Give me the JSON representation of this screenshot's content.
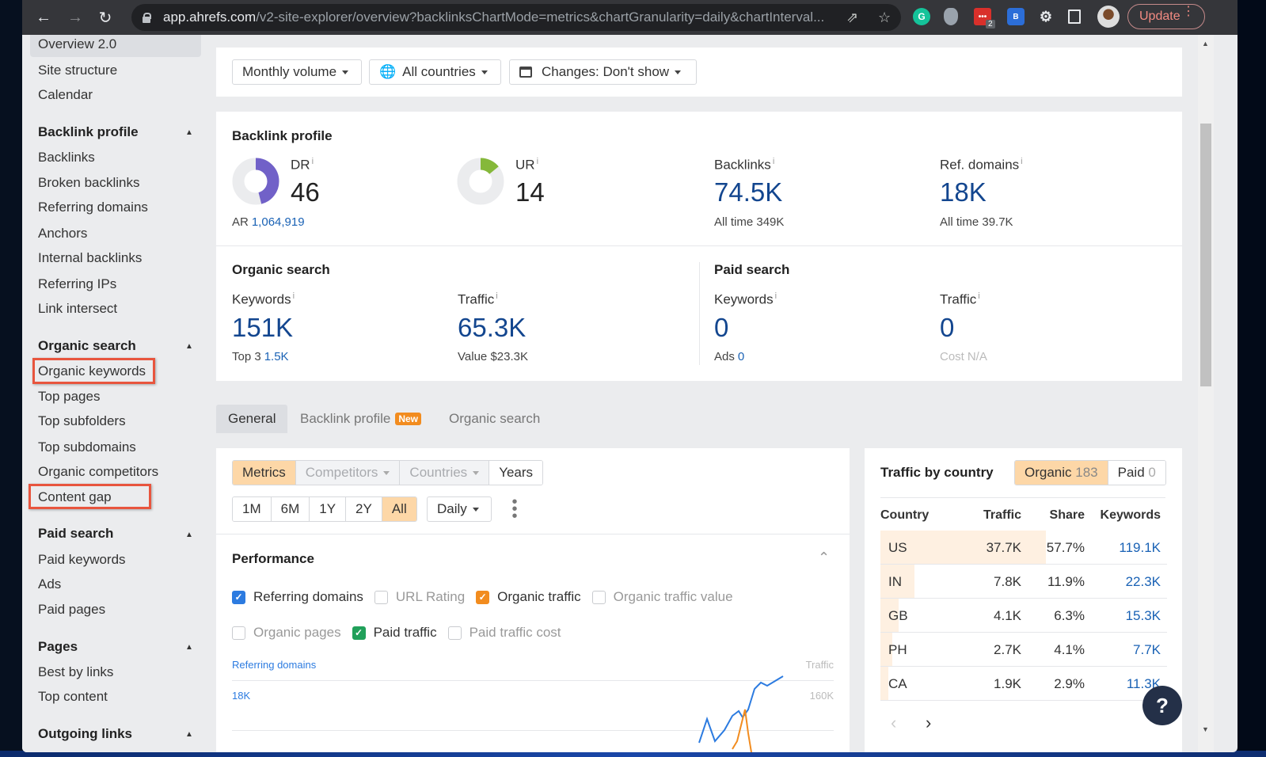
{
  "browser": {
    "url_host": "app.ahrefs.com",
    "url_path": "/v2-site-explorer/overview?backlinksChartMode=metrics&chartGranularity=daily&chartInterval...",
    "extension_badge": "2",
    "update_label": "Update"
  },
  "sidebar": {
    "top_items": [
      "Overview 2.0",
      "Site structure",
      "Calendar"
    ],
    "sections": [
      {
        "title": "Backlink profile",
        "items": [
          "Backlinks",
          "Broken backlinks",
          "Referring domains",
          "Anchors",
          "Internal backlinks",
          "Referring IPs",
          "Link intersect"
        ]
      },
      {
        "title": "Organic search",
        "items": [
          "Organic keywords",
          "Top pages",
          "Top subfolders",
          "Top subdomains",
          "Organic competitors",
          "Content gap"
        ]
      },
      {
        "title": "Paid search",
        "items": [
          "Paid keywords",
          "Ads",
          "Paid pages"
        ]
      },
      {
        "title": "Pages",
        "items": [
          "Best by links",
          "Top content"
        ]
      },
      {
        "title": "Outgoing links",
        "items": []
      }
    ]
  },
  "filters": {
    "volume": "Monthly volume",
    "countries": "All countries",
    "changes": "Changes: Don't show"
  },
  "backlink_profile": {
    "title": "Backlink profile",
    "dr_label": "DR",
    "dr_value": "46",
    "dr_percent": 46,
    "ar_label": "AR",
    "ar_value": "1,064,919",
    "ur_label": "UR",
    "ur_value": "14",
    "ur_percent": 14,
    "backlinks_label": "Backlinks",
    "backlinks_value": "74.5K",
    "backlinks_alltime_label": "All time",
    "backlinks_alltime_value": "349K",
    "refdomains_label": "Ref. domains",
    "refdomains_value": "18K",
    "refdomains_alltime_label": "All time",
    "refdomains_alltime_value": "39.7K",
    "info": "i"
  },
  "organic_search": {
    "title": "Organic search",
    "keywords_label": "Keywords",
    "keywords_value": "151K",
    "top3_label": "Top 3",
    "top3_value": "1.5K",
    "traffic_label": "Traffic",
    "traffic_value": "65.3K",
    "value_label": "Value",
    "value_value": "$23.3K"
  },
  "paid_search": {
    "title": "Paid search",
    "keywords_label": "Keywords",
    "keywords_value": "0",
    "ads_label": "Ads",
    "ads_value": "0",
    "traffic_label": "Traffic",
    "traffic_value": "0",
    "cost_label": "Cost",
    "cost_value": "N/A"
  },
  "tabs": [
    {
      "label": "General",
      "active": true
    },
    {
      "label": "Backlink profile",
      "badge": "New"
    },
    {
      "label": "Organic search"
    }
  ],
  "chart_controls": {
    "modes": [
      "Metrics",
      "Competitors",
      "Countries",
      "Years"
    ],
    "ranges": [
      "1M",
      "6M",
      "1Y",
      "2Y",
      "All"
    ],
    "active_range": "All",
    "granularity": "Daily"
  },
  "performance": {
    "title": "Performance",
    "checkboxes": [
      {
        "label": "Referring domains",
        "checked": true,
        "color": "#2c7be0"
      },
      {
        "label": "URL Rating",
        "checked": false
      },
      {
        "label": "Organic traffic",
        "checked": true,
        "color": "#f28c1f"
      },
      {
        "label": "Organic traffic value",
        "checked": false
      },
      {
        "label": "Organic pages",
        "checked": false
      },
      {
        "label": "Paid traffic",
        "checked": true,
        "color": "#21a05a"
      },
      {
        "label": "Paid traffic cost",
        "checked": false
      }
    ],
    "left_axis_label": "Referring domains",
    "right_axis_label": "Traffic",
    "left_tick": "18K",
    "right_tick": "160K"
  },
  "traffic_by_country": {
    "title": "Traffic by country",
    "organic_label": "Organic",
    "organic_count": "183",
    "paid_label": "Paid",
    "paid_count": "0",
    "headers": [
      "Country",
      "Traffic",
      "Share",
      "Keywords"
    ],
    "rows": [
      {
        "country": "US",
        "traffic": "37.7K",
        "share": "57.7%",
        "share_num": 57.7,
        "keywords": "119.1K"
      },
      {
        "country": "IN",
        "traffic": "7.8K",
        "share": "11.9%",
        "share_num": 11.9,
        "keywords": "22.3K"
      },
      {
        "country": "GB",
        "traffic": "4.1K",
        "share": "6.3%",
        "share_num": 6.3,
        "keywords": "15.3K"
      },
      {
        "country": "PH",
        "traffic": "2.7K",
        "share": "4.1%",
        "share_num": 4.1,
        "keywords": "7.7K"
      },
      {
        "country": "CA",
        "traffic": "1.9K",
        "share": "2.9%",
        "share_num": 2.9,
        "keywords": "11.3K"
      }
    ]
  },
  "help_label": "?"
}
